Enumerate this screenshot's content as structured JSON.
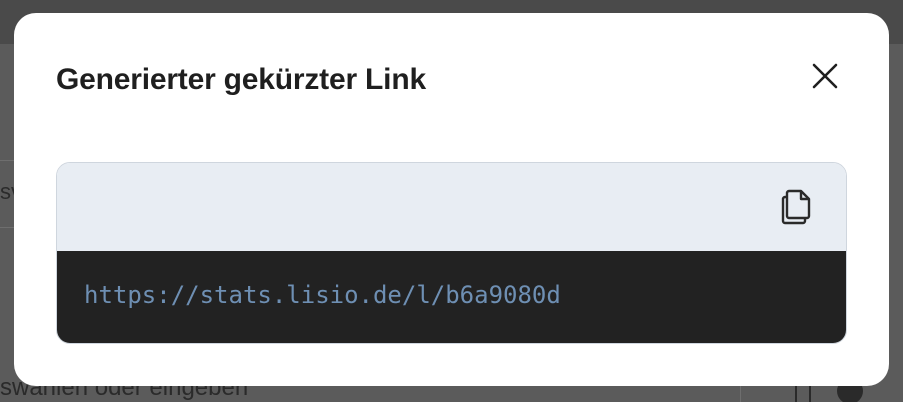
{
  "background": {
    "partial_field_text": "sv",
    "placeholder_text": "swählen oder eingeben"
  },
  "modal": {
    "title": "Generierter gekürzter Link",
    "close_icon": "close-icon",
    "copy_icon": "copy-icon",
    "short_url": "https://stats.lisio.de/l/b6a9080d"
  },
  "colors": {
    "code_header_bg": "#e8edf3",
    "code_body_bg": "#222222",
    "url_text": "#6e8fb3"
  }
}
